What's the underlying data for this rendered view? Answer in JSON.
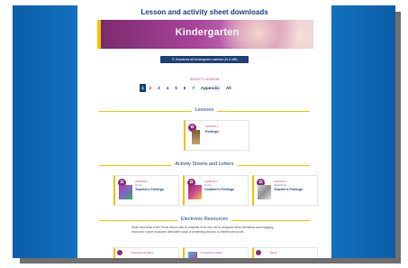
{
  "page": {
    "title": "Lesson and activity sheet downloads",
    "banner_title": "Kindergarten",
    "download_button": "Download all Kindergarten material (31.6 MB)",
    "select_label": "SELECT LESSON",
    "pager": [
      "1",
      "2",
      "3",
      "4",
      "5",
      "6",
      "7",
      "Appendix",
      "All"
    ],
    "pager_active_index": 0
  },
  "lessons": {
    "heading": "Lessons",
    "cards": [
      {
        "meta1": "LESSON 1",
        "title": "Feelings"
      }
    ]
  },
  "activity": {
    "heading": "Activity Sheets and Letters",
    "cards": [
      {
        "meta1": "LESSON 1",
        "meta2": "Home",
        "title": "Teacher's Feelings"
      },
      {
        "meta1": "LESSON 1",
        "meta2": "Home",
        "title": "Children's Feelings"
      },
      {
        "meta1": "LESSON 1",
        "meta2": "Worksheet",
        "title": "Teacher's Feelings"
      }
    ]
  },
  "electronic": {
    "heading": "Electronic Resources",
    "body": "While each links in the Focus lesson plan is complete in its own, we've designed these interactive and engaging resources to give educators alternative ways of presenting lessons to children and youth.",
    "cards": [
      {
        "meta1": "PowerPoint Slides"
      },
      {
        "meta1": "PowerPoint Slides"
      },
      {
        "meta1": "Music"
      }
    ]
  },
  "colors": {
    "navy": "#1e3f78",
    "magenta": "#b0407e",
    "gold": "#f1c200",
    "frame_blue": "#1a7fd0"
  },
  "icons": {
    "download": "download-icon",
    "lesson_badge": "lesson-badge-icon"
  }
}
